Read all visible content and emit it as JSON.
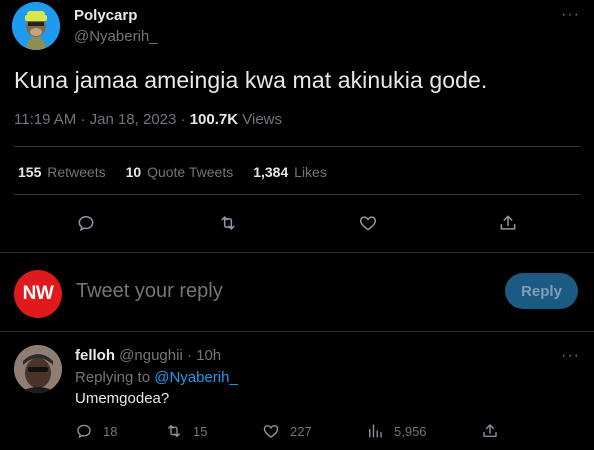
{
  "tweet": {
    "author_name": "Polycarp",
    "author_handle": "@Nyaberih_",
    "text": "Kuna jamaa ameingia kwa mat akinukia gode.",
    "time": "11:19 AM",
    "date": "Jan 18, 2023",
    "views_count": "100.7K",
    "views_label": "Views",
    "more": "···",
    "stats": {
      "retweets_count": "155",
      "retweets_label": "Retweets",
      "quotes_count": "10",
      "quotes_label": "Quote Tweets",
      "likes_count": "1,384",
      "likes_label": "Likes"
    },
    "actions": [
      "reply-icon",
      "retweet-icon",
      "like-icon",
      "share-icon"
    ]
  },
  "compose": {
    "avatar_text": "NW",
    "placeholder": "Tweet your reply",
    "button_label": "Reply"
  },
  "reply": {
    "author_name": "felloh",
    "author_handle": "@ngughii",
    "separator": "·",
    "time": "10h",
    "replying_prefix": "Replying to",
    "replying_to": "@Nyaberih_",
    "text": "Umemgodea?",
    "more": "···",
    "reply_count": "18",
    "retweet_count": "15",
    "like_count": "227",
    "views_count": "5,956"
  },
  "colors": {
    "background": "#000000",
    "accent": "#1d9bf0",
    "muted": "#71767b",
    "text": "#e7e9ea",
    "divider": "#2f3336",
    "brand_red": "#e0191d"
  }
}
